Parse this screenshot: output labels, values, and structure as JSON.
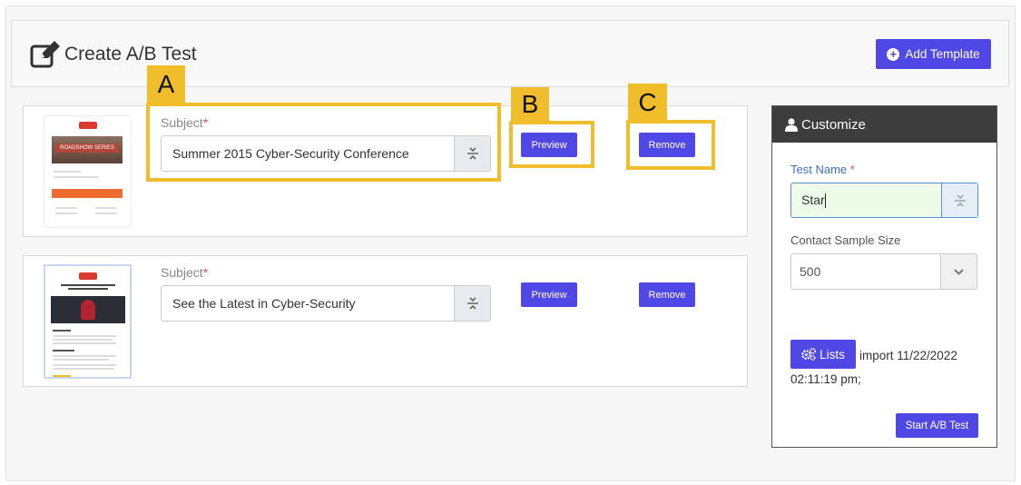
{
  "header": {
    "title": "Create A/B Test",
    "add_template_label": "Add Template"
  },
  "templates": [
    {
      "subject_label": "Subject",
      "required_mark": "*",
      "subject_value": "Summer 2015 Cyber-Security Conference",
      "preview_label": "Preview",
      "remove_label": "Remove",
      "thumbnail_banner_text": "ROADSHOW SERIES"
    },
    {
      "subject_label": "Subject",
      "required_mark": "*",
      "subject_value": "See the Latest in Cyber-Security",
      "preview_label": "Preview",
      "remove_label": "Remove"
    }
  ],
  "callouts": {
    "a": "A",
    "b": "B",
    "c": "C"
  },
  "customize": {
    "title": "Customize",
    "test_name_label": "Test Name",
    "required_mark": "*",
    "test_name_value": "Star",
    "sample_size_label": "Contact Sample Size",
    "sample_size_value": "500",
    "lists_label": "Lists",
    "lists_info": "import 11/22/2022 02:11:19 pm;",
    "start_label": "Start A/B Test"
  },
  "colors": {
    "primary": "#5048e5",
    "highlight": "#f0bd2b",
    "panel_header": "#3d3d3d"
  }
}
